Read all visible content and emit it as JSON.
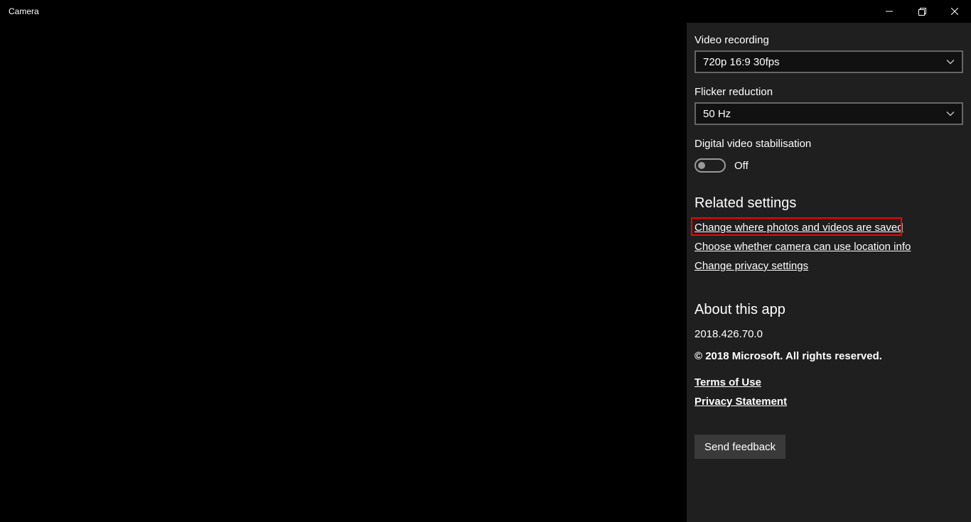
{
  "titlebar": {
    "title": "Camera"
  },
  "settings": {
    "video_recording_label": "Video recording",
    "video_recording_value": "720p 16:9 30fps",
    "flicker_label": "Flicker reduction",
    "flicker_value": "50 Hz",
    "stabilisation_label": "Digital video stabilisation",
    "stabilisation_state": "Off"
  },
  "related": {
    "heading": "Related settings",
    "links": {
      "save_location": "Change where photos and videos are saved",
      "location_info": "Choose whether camera can use location info",
      "privacy": "Change privacy settings"
    }
  },
  "about": {
    "heading": "About this app",
    "version": "2018.426.70.0",
    "copyright": "© 2018 Microsoft. All rights reserved.",
    "terms": "Terms of Use",
    "privacy_statement": "Privacy Statement"
  },
  "feedback": {
    "button": "Send feedback"
  }
}
